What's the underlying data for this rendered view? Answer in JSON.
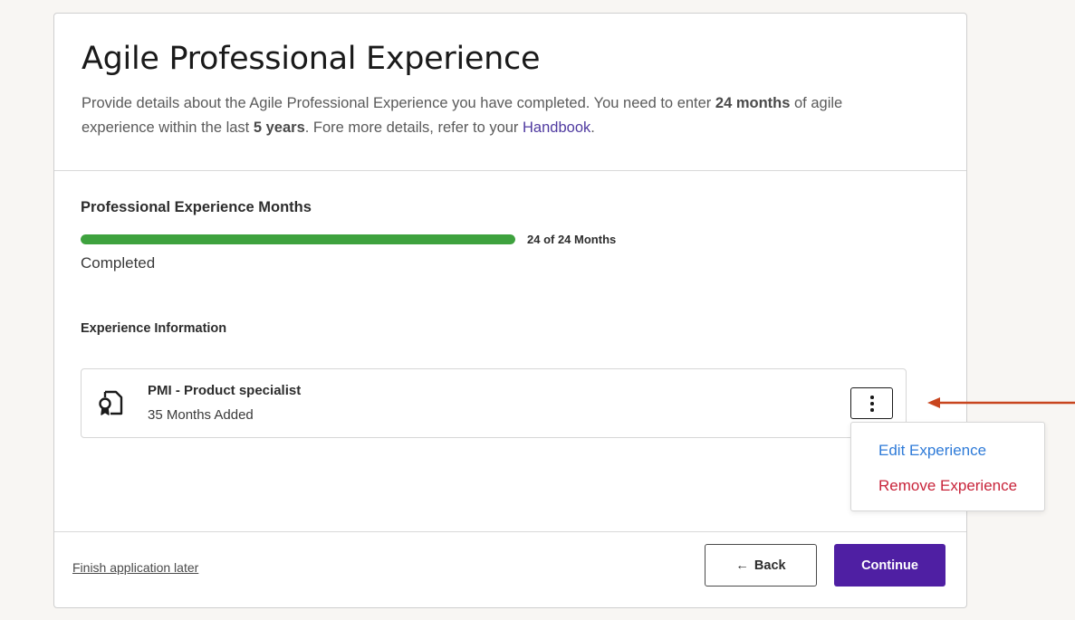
{
  "page": {
    "title": "Agile Professional Experience",
    "description": {
      "part1": "Provide details about the Agile Professional Experience you have completed. You need to enter ",
      "bold1": "24 months",
      "part2": " of agile experience within the last ",
      "bold2": "5 years",
      "part3": ". Fore more details, refer to your ",
      "link": "Handbook",
      "part4": "."
    }
  },
  "progress": {
    "section_title": "Professional Experience Months",
    "label": "24 of 24 Months",
    "fraction": 1.0,
    "status": "Completed",
    "color": "#3ea23e"
  },
  "experience": {
    "section_title": "Experience Information",
    "items": [
      {
        "name": "PMI - Product specialist",
        "months": "35 Months Added",
        "icon": "certificate-icon"
      }
    ]
  },
  "menu": {
    "edit_label": "Edit Experience",
    "remove_label": "Remove Experience"
  },
  "footer": {
    "later_label": "Finish application later",
    "back_label": "Back",
    "back_icon": "arrow-left-icon",
    "continue_label": "Continue",
    "continue_color": "#4f1fa3"
  },
  "annotation": {
    "arrow_color": "#c8451e"
  }
}
